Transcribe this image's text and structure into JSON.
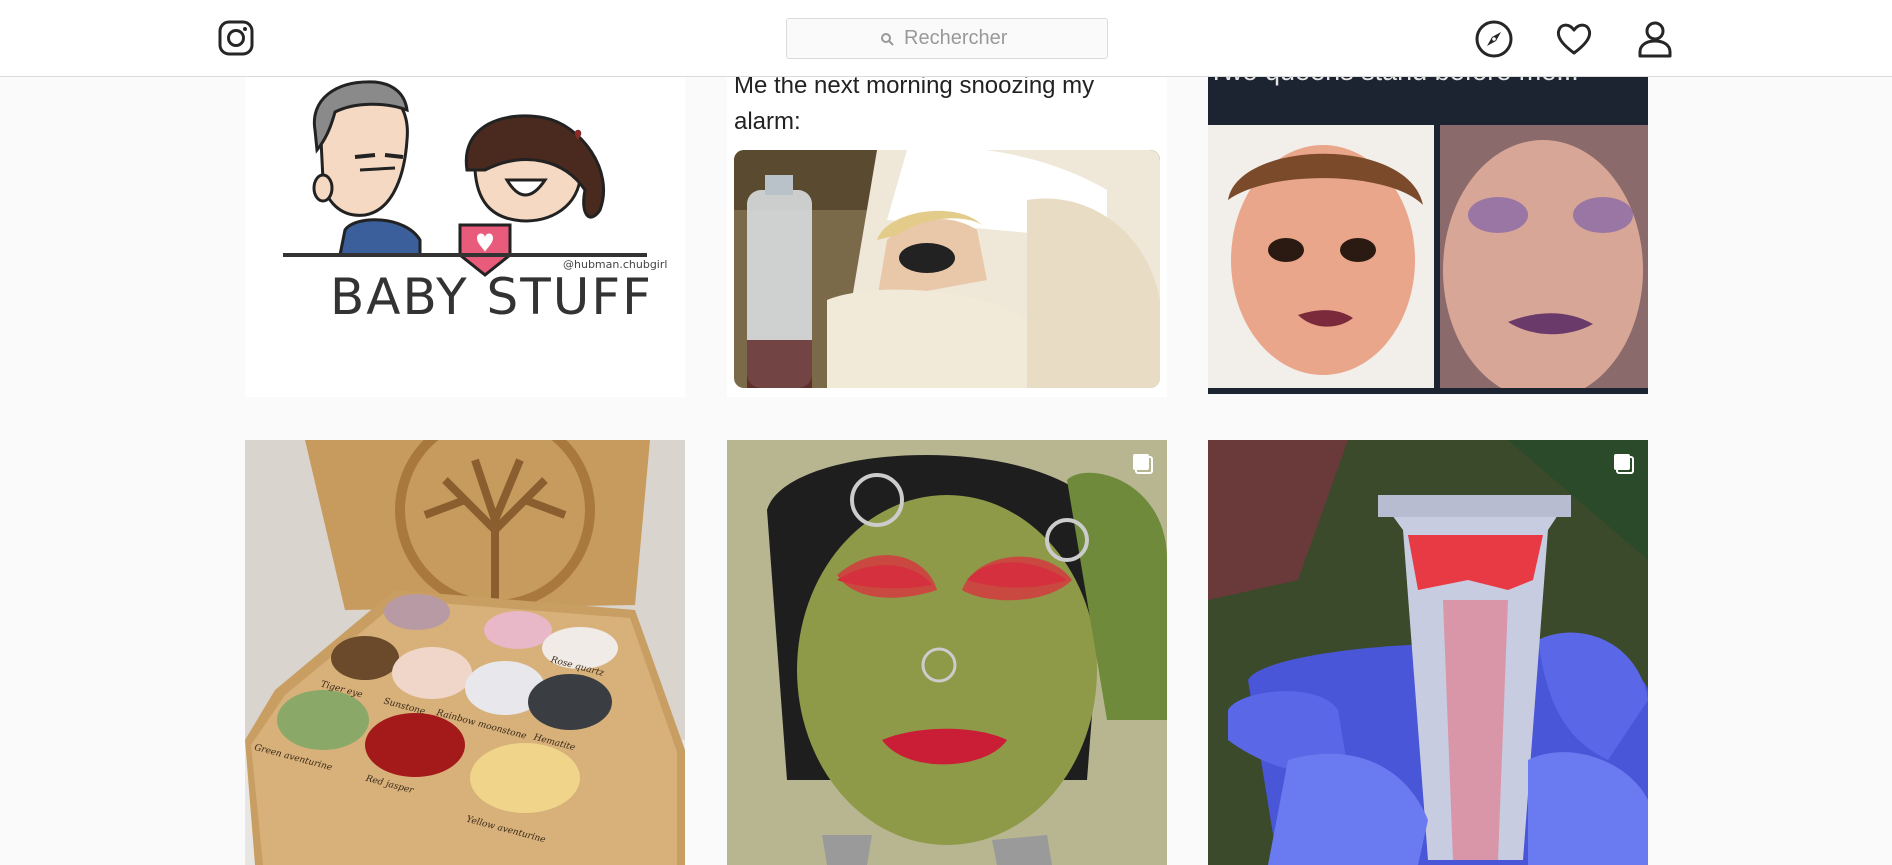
{
  "header": {
    "search_placeholder": "Rechercher",
    "logo_icon": "instagram-logo-icon",
    "nav_icons": [
      "compass-icon",
      "heart-icon",
      "user-icon"
    ]
  },
  "posts": [
    {
      "id": "baby-stuff",
      "title": "BABY STUFF",
      "credit": "@hubman.chubgirl"
    },
    {
      "id": "snooze-meme",
      "caption": "Me the next morning snoozing my alarm:"
    },
    {
      "id": "queens-meme",
      "caption": "Two queens stand before me..."
    },
    {
      "id": "stone-palette",
      "stones": [
        "Tiger eye",
        "Sunstone",
        "Rainbow moonstone",
        "Hematite",
        "Green aventurine",
        "Red jasper",
        "Yellow aventurine",
        "Rose quartz"
      ]
    },
    {
      "id": "green-makeup",
      "multi": true
    },
    {
      "id": "glitter-tube",
      "multi": true
    }
  ],
  "colors": {
    "background": "#fafafa",
    "header": "#ffffff",
    "border": "#dbdbdb",
    "icon": "#262626"
  }
}
